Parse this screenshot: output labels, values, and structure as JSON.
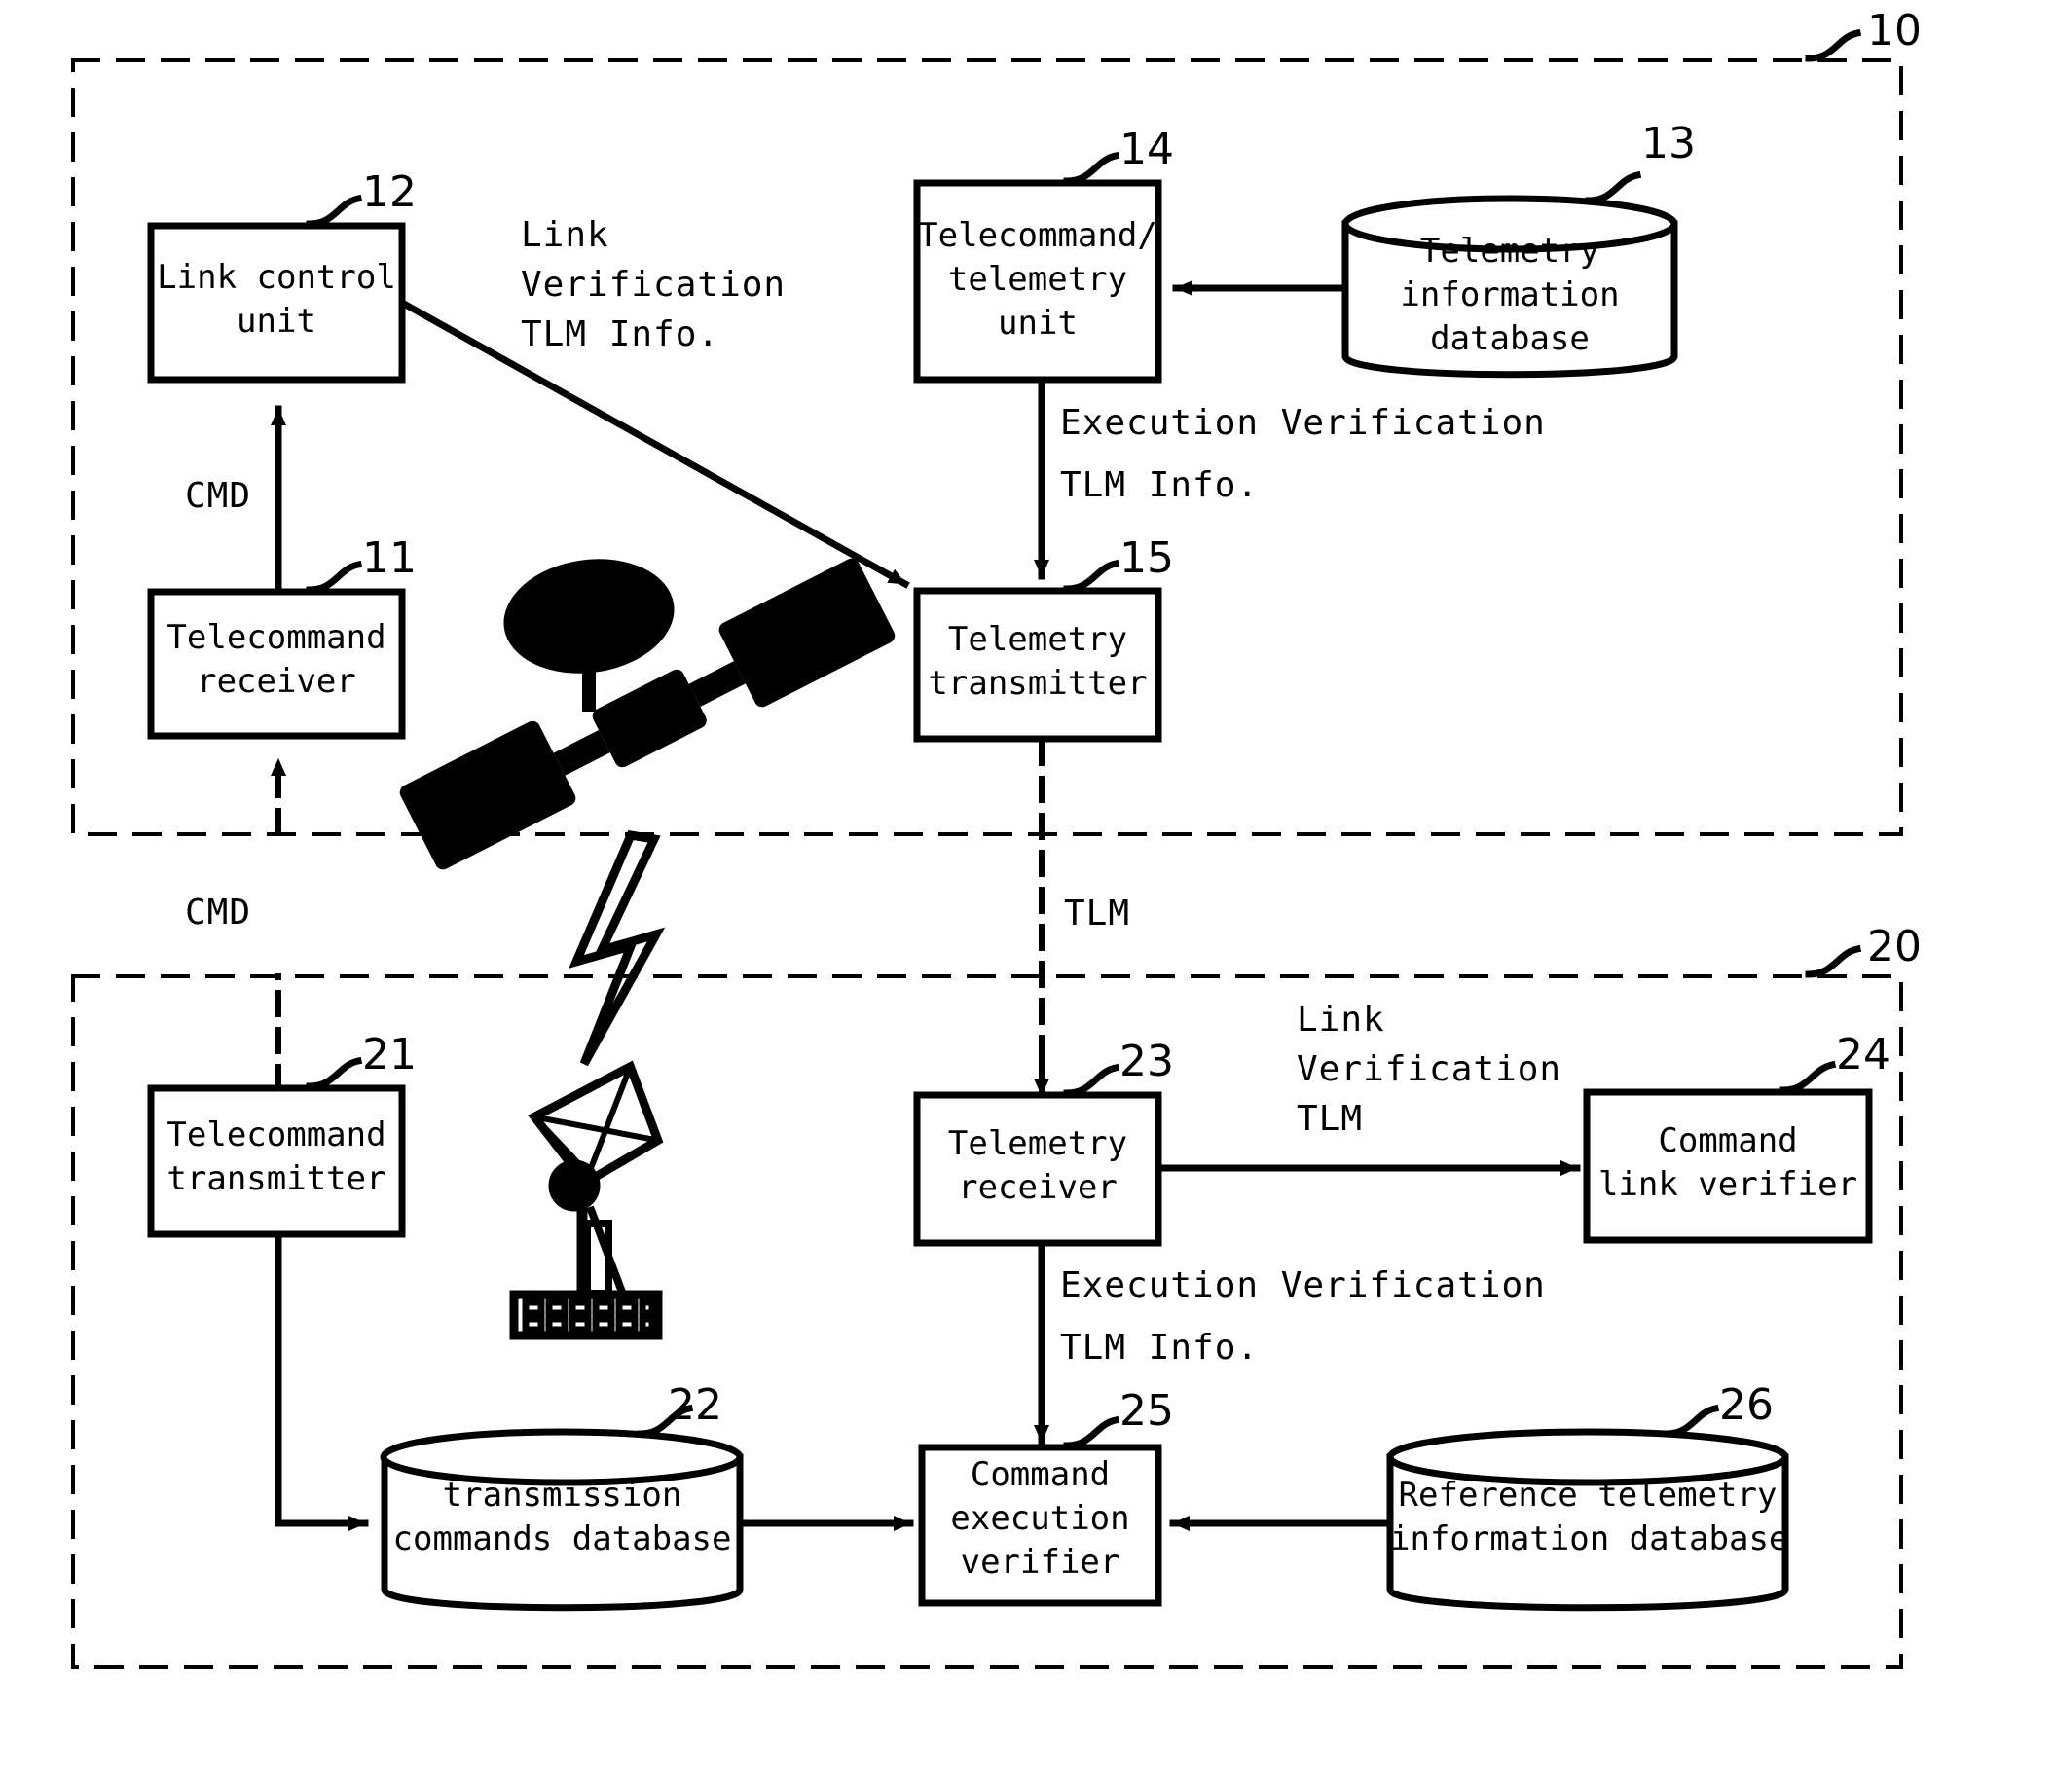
{
  "figure": {
    "type": "patent-block-diagram",
    "title": "",
    "groups": [
      {
        "id": "10",
        "ref": "10",
        "name": "satellite-segment"
      },
      {
        "id": "20",
        "ref": "20",
        "name": "ground-segment"
      }
    ]
  },
  "blocks": [
    {
      "ref": "11",
      "lines": [
        "Telecommand",
        "receiver"
      ],
      "shape": "rect",
      "name": "telecommand-receiver"
    },
    {
      "ref": "12",
      "lines": [
        "Link control",
        "unit"
      ],
      "shape": "rect",
      "name": "link-control-unit"
    },
    {
      "ref": "13",
      "lines": [
        "Telemetry",
        "information",
        "database"
      ],
      "shape": "cylinder",
      "name": "telemetry-information-database"
    },
    {
      "ref": "14",
      "lines": [
        "Telecommand/",
        "telemetry",
        "unit"
      ],
      "shape": "rect",
      "name": "telecommand-telemetry-unit"
    },
    {
      "ref": "15",
      "lines": [
        "Telemetry",
        "transmitter"
      ],
      "shape": "rect",
      "name": "telemetry-transmitter"
    },
    {
      "ref": "21",
      "lines": [
        "Telecommand",
        "transmitter"
      ],
      "shape": "rect",
      "name": "telecommand-transmitter"
    },
    {
      "ref": "22",
      "lines": [
        "transmission",
        "commands database"
      ],
      "shape": "cylinder",
      "name": "transmission-commands-database"
    },
    {
      "ref": "23",
      "lines": [
        "Telemetry",
        "receiver"
      ],
      "shape": "rect",
      "name": "telemetry-receiver"
    },
    {
      "ref": "24",
      "lines": [
        "Command",
        "link verifier"
      ],
      "shape": "rect",
      "name": "command-link-verifier"
    },
    {
      "ref": "25",
      "lines": [
        "Command",
        "execution",
        "verifier"
      ],
      "shape": "rect",
      "name": "command-execution-verifier"
    },
    {
      "ref": "26",
      "lines": [
        "Reference telemetry",
        "information database"
      ],
      "shape": "cylinder",
      "name": "reference-telemetry-information-database"
    }
  ],
  "flow_labels": {
    "link_verification_tlm_info": [
      "Link",
      "Verification",
      "TLM Info."
    ],
    "execution_verification_tlm_info_top": [
      "Execution Verification",
      "TLM Info."
    ],
    "cmd_top": "CMD",
    "cmd_link": "CMD",
    "tlm_link": "TLM",
    "link_verification_tlm": [
      "Link",
      "Verification",
      "TLM"
    ],
    "execution_verification_tlm_info_bottom": [
      "Execution Verification",
      "TLM Info."
    ]
  },
  "icons": [
    {
      "name": "satellite-icon",
      "label": "satellite"
    },
    {
      "name": "lightning-bolt-icon",
      "label": "radio link"
    },
    {
      "name": "ground-station-antenna-icon",
      "label": "ground antenna"
    }
  ],
  "colors": {
    "stroke": "#000000",
    "background": "#ffffff"
  }
}
